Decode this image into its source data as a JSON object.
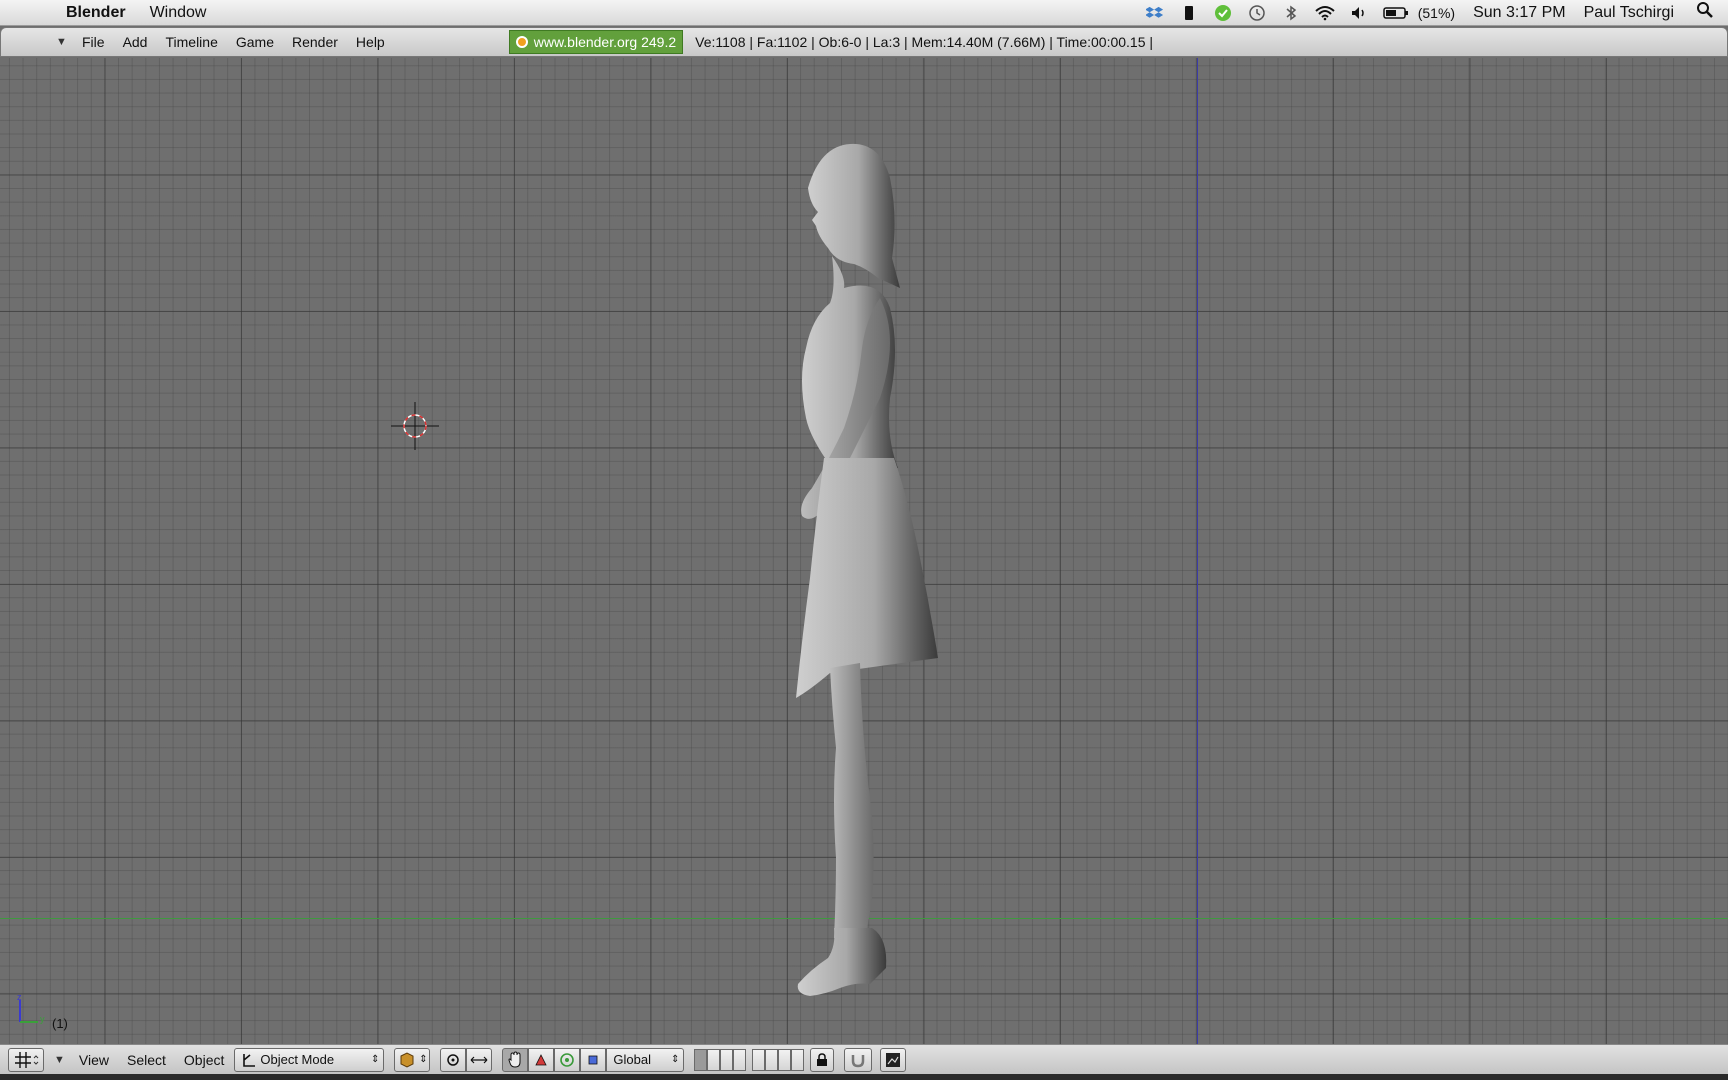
{
  "macbar": {
    "apple_symbol": "",
    "app_name": "Blender",
    "menus": [
      "Window"
    ],
    "tray_icons": [
      "dropbox-icon",
      "usb-icon",
      "shield-check-icon",
      "time-machine-icon",
      "bluetooth-icon",
      "wifi-icon",
      "volume-icon",
      "battery-icon"
    ],
    "battery_percent": "(51%)",
    "clock": "Sun 3:17 PM",
    "user": "Paul Tschirgi"
  },
  "infobar": {
    "menus": [
      "File",
      "Add",
      "Timeline",
      "Game",
      "Render",
      "Help"
    ],
    "version_label": "www.blender.org 249.2",
    "stats": "Ve:1108 | Fa:1102 | Ob:6-0 | La:3  | Mem:14.40M (7.66M)  | Time:00:00.15 |"
  },
  "viewport": {
    "frame_label": "(1)",
    "axis_labels": {
      "z": "z",
      "y": "y"
    },
    "colors": {
      "z_axis": "#3b3ba8",
      "y_axis": "#3f9a3f",
      "grid": "#6f6f6f"
    }
  },
  "bottombar": {
    "menus": [
      "View",
      "Select",
      "Object"
    ],
    "mode": "Object Mode",
    "orientation": "Global"
  }
}
